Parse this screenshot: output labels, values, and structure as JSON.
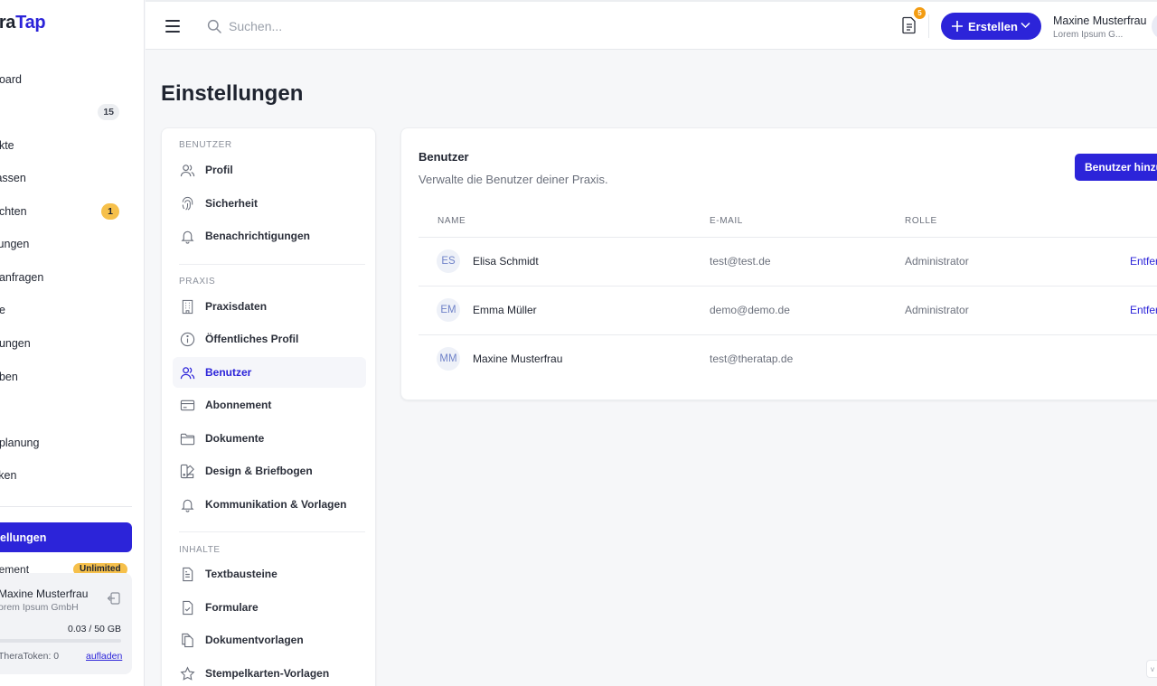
{
  "brand": {
    "part1": "era",
    "part2": "Tap"
  },
  "appnav": {
    "items": [
      {
        "label": "board",
        "badge": ""
      },
      {
        "label": "",
        "badge": "15"
      },
      {
        "label": "akte",
        "badge": ""
      },
      {
        "label": "fassen",
        "badge": ""
      },
      {
        "label": "richten",
        "badge": "1"
      },
      {
        "label": "ilungen",
        "badge": ""
      },
      {
        "label": "nanfragen",
        "badge": ""
      },
      {
        "label": "ne",
        "badge": ""
      },
      {
        "label": "hungen",
        "badge": ""
      },
      {
        "label": "aben",
        "badge": ""
      },
      {
        "label": "",
        "badge": ""
      },
      {
        "label": "nplanung",
        "badge": ""
      },
      {
        "label": "tiken",
        "badge": ""
      }
    ],
    "active_label": "ellungen",
    "abo_label": "nement",
    "abo_pill": "Unlimited",
    "user": {
      "name": "Maxine Musterfrau",
      "company": "orem Ipsum GmbH",
      "storage": "0.03 / 50 GB",
      "storage_fraction": 0.0006,
      "tokens": "TheraToken: 0",
      "recharge": "aufladen"
    }
  },
  "topbar": {
    "search_placeholder": "Suchen...",
    "doc_badge": "5",
    "create_label": "Erstellen",
    "user_name": "Maxine Musterfrau",
    "user_company": "Lorem Ipsum G..."
  },
  "page_title": "Einstellungen",
  "settings_nav": {
    "sections": [
      {
        "title": "BENUTZER",
        "items": [
          {
            "label": "Profil",
            "icon": "users-icon"
          },
          {
            "label": "Sicherheit",
            "icon": "fingerprint-icon"
          },
          {
            "label": "Benachrichtigungen",
            "icon": "bell-icon"
          }
        ]
      },
      {
        "title": "PRAXIS",
        "items": [
          {
            "label": "Praxisdaten",
            "icon": "building-icon"
          },
          {
            "label": "Öffentliches Profil",
            "icon": "info-icon"
          },
          {
            "label": "Benutzer",
            "icon": "users-icon"
          },
          {
            "label": "Abonnement",
            "icon": "credit-card-icon"
          },
          {
            "label": "Dokumente",
            "icon": "folder-icon"
          },
          {
            "label": "Design & Briefbogen",
            "icon": "palette-icon"
          },
          {
            "label": "Kommunikation & Vorlagen",
            "icon": "bell-icon"
          }
        ]
      },
      {
        "title": "INHALTE",
        "items": [
          {
            "label": "Textbausteine",
            "icon": "document-icon"
          },
          {
            "label": "Formulare",
            "icon": "form-check-icon"
          },
          {
            "label": "Dokumentvorlagen",
            "icon": "copy-icon"
          },
          {
            "label": "Stempelkarten-Vorlagen",
            "icon": "star-icon"
          }
        ]
      }
    ],
    "active": "Benutzer"
  },
  "users_card": {
    "title": "Benutzer",
    "subtitle": "Verwalte die Benutzer deiner Praxis.",
    "add_button": "Benutzer hinzufügen",
    "columns": {
      "name": "NAME",
      "email": "E-MAIL",
      "role": "ROLLE"
    },
    "rows": [
      {
        "initials": "ES",
        "name": "Elisa Schmidt",
        "email": "test@test.de",
        "role": "Administrator",
        "action": "Entfernen"
      },
      {
        "initials": "EM",
        "name": "Emma Müller",
        "email": "demo@demo.de",
        "role": "Administrator",
        "action": "Entfernen"
      },
      {
        "initials": "MM",
        "name": "Maxine Musterfrau",
        "email": "test@theratap.de",
        "role": "",
        "action": ""
      }
    ]
  },
  "colors": {
    "accent": "#2c24d9",
    "badge_yellow": "#f6c04b",
    "badge_orange": "#f39c12"
  },
  "corner_tab": "v"
}
